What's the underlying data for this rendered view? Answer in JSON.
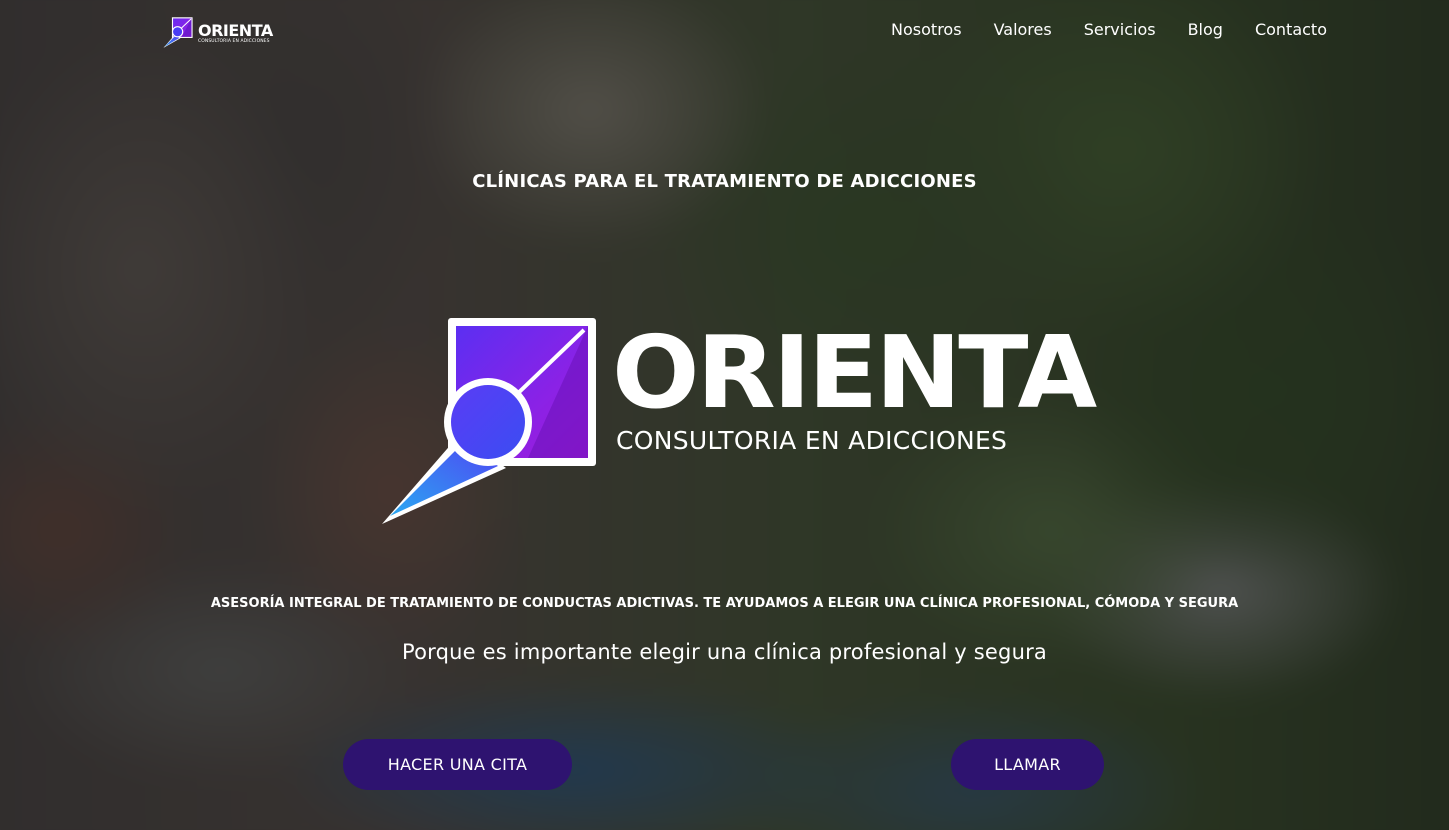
{
  "header": {
    "logo_word": "ORIENTA",
    "logo_sub": "CONSULTORIA EN ADICCIONES",
    "nav": [
      {
        "label": "Nosotros"
      },
      {
        "label": "Valores"
      },
      {
        "label": "Servicios"
      },
      {
        "label": "Blog"
      },
      {
        "label": "Contacto"
      }
    ]
  },
  "hero": {
    "eyebrow": "CLÍNICAS PARA EL TRATAMIENTO DE ADICCIONES",
    "logo_word": "ORIENTA",
    "logo_sub": "CONSULTORIA EN ADICCIONES",
    "tagline": "ASESORÍA INTEGRAL DE TRATAMIENTO DE CONDUCTAS ADICTIVAS. TE AYUDAMOS A ELEGIR UNA CLÍNICA PROFESIONAL, CÓMODA Y SEGURA",
    "subtitle": "Porque es importante elegir una clínica profesional y segura",
    "buttons": {
      "appointment": "HACER UNA CITA",
      "call": "LLAMAR"
    }
  },
  "colors": {
    "button_bg": "#2e1370",
    "logo_purple": "#7a1fe0",
    "logo_blue": "#2f7bf0",
    "text": "#ffffff"
  },
  "icons": {
    "logo_mark": "compass-pin-icon"
  }
}
